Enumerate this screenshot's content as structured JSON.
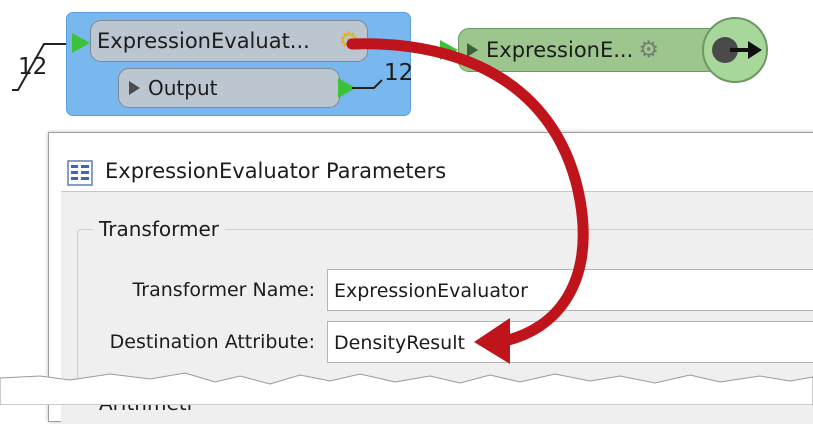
{
  "canvas": {
    "input_count": "12",
    "output_count": "12",
    "source_node": {
      "label": "ExpressionEvaluat...",
      "output_port_label": "Output",
      "gear_icon": "gear-icon"
    },
    "target_node": {
      "label": "ExpressionE...",
      "gear_icon": "gear-icon"
    },
    "colors": {
      "selection": "#78b8ee",
      "node_gray": "#bcc6d0",
      "node_green": "#9cc68e",
      "port_green": "#3cc23a",
      "arrow_red": "#c0141c"
    }
  },
  "dialog": {
    "title": "ExpressionEvaluator Parameters",
    "title_icon": "parameters-icon",
    "group_title": "Transformer",
    "fields": {
      "transformer_name": {
        "label": "Transformer Name:",
        "value": "ExpressionEvaluator"
      },
      "destination_attribute": {
        "label": "Destination Attribute:",
        "value": "DensityResult"
      }
    },
    "next_group_title_partial": "Arithmeti"
  }
}
